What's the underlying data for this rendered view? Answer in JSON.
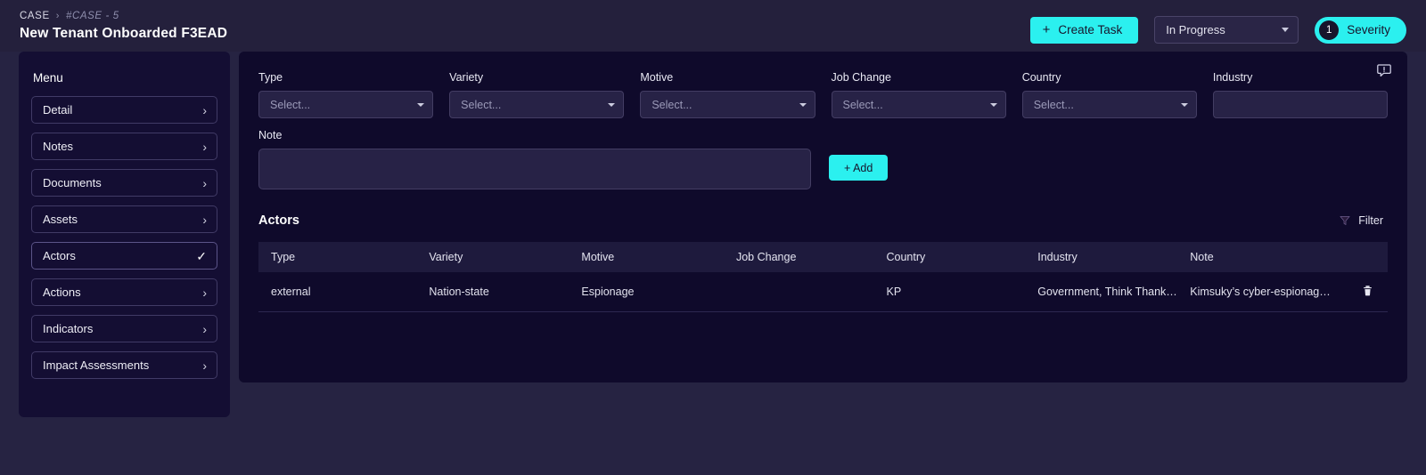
{
  "header": {
    "breadcrumb": {
      "root": "CASE",
      "separator": "›",
      "current": "#CASE - 5"
    },
    "title": "New Tenant Onboarded F3EAD",
    "create_task_label": "Create Task",
    "create_task_icon": "plus-icon",
    "status_value": "In Progress",
    "severity_count": "1",
    "severity_label": "Severity"
  },
  "sidebar": {
    "menu_title": "Menu",
    "items": [
      {
        "label": "Detail",
        "icon": "chevron-right-icon",
        "active": false
      },
      {
        "label": "Notes",
        "icon": "chevron-right-icon",
        "active": false
      },
      {
        "label": "Documents",
        "icon": "chevron-right-icon",
        "active": false
      },
      {
        "label": "Assets",
        "icon": "chevron-right-icon",
        "active": false
      },
      {
        "label": "Actors",
        "icon": "check-icon",
        "active": true
      },
      {
        "label": "Actions",
        "icon": "chevron-right-icon",
        "active": false
      },
      {
        "label": "Indicators",
        "icon": "chevron-right-icon",
        "active": false
      },
      {
        "label": "Impact Assessments",
        "icon": "chevron-right-icon",
        "active": false
      }
    ]
  },
  "main": {
    "alert_icon": "comment-alert-icon",
    "fields": [
      {
        "label": "Type",
        "placeholder": "Select...",
        "type": "select"
      },
      {
        "label": "Variety",
        "placeholder": "Select...",
        "type": "select"
      },
      {
        "label": "Motive",
        "placeholder": "Select...",
        "type": "select"
      },
      {
        "label": "Job Change",
        "placeholder": "Select...",
        "type": "select"
      },
      {
        "label": "Country",
        "placeholder": "Select...",
        "type": "select"
      },
      {
        "label": "Industry",
        "placeholder": "",
        "type": "text"
      }
    ],
    "note": {
      "label": "Note",
      "value": "",
      "placeholder": ""
    },
    "add_label": "+ Add",
    "actors": {
      "title": "Actors",
      "filter_label": "Filter",
      "filter_icon": "funnel-icon",
      "columns": [
        "Type",
        "Variety",
        "Motive",
        "Job Change",
        "Country",
        "Industry",
        "Note",
        ""
      ],
      "rows": [
        {
          "type": "external",
          "variety": "Nation-state",
          "motive": "Espionage",
          "job_change": "",
          "country": "KP",
          "industry": "Government, Think Thank…",
          "note": "Kimsuky’s cyber-espionag…",
          "delete_icon": "trash-icon"
        }
      ]
    }
  },
  "colors": {
    "accent": "#2bf0ef",
    "page_bg": "#262342",
    "header_bg": "#24203c",
    "sidebar_bg": "#140e33",
    "panel_bg": "#0f0a2b",
    "table_head_bg": "#1e1a3d"
  }
}
